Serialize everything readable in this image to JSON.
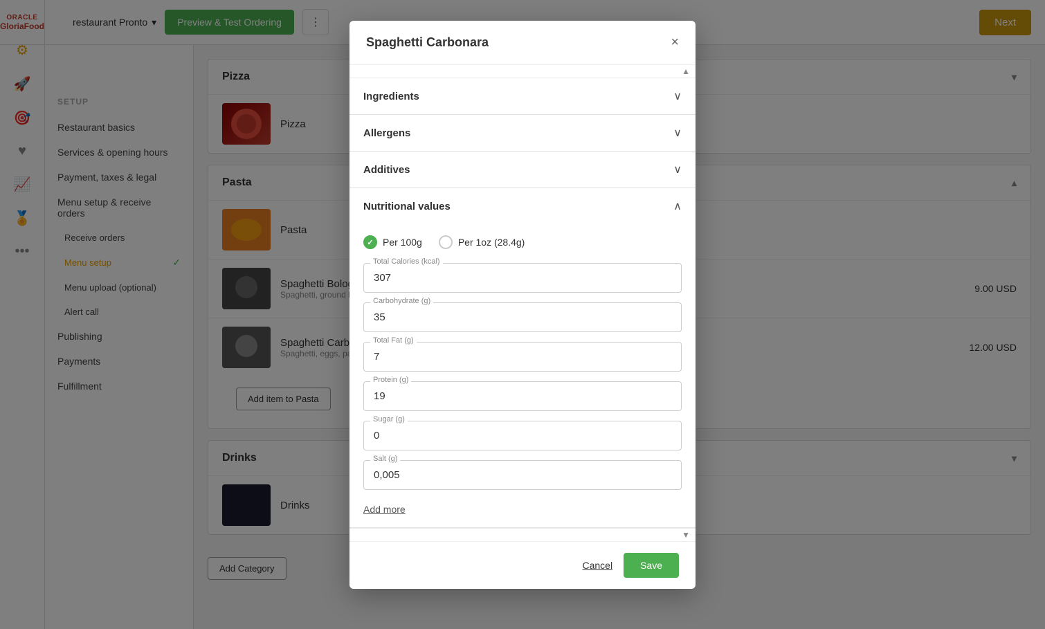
{
  "oracle": {
    "line1": "ORACLE",
    "line2": "GloriaFood"
  },
  "topbar": {
    "restaurant": "restaurant Pronto",
    "preview_label": "Preview & Test Ordering",
    "next_label": "Next"
  },
  "sidebar": {
    "setup_label": "SETUP",
    "nav_items": [
      {
        "label": "Restaurant basics",
        "sub": false
      },
      {
        "label": "Services & opening hours",
        "sub": false
      },
      {
        "label": "Payment, taxes & legal",
        "sub": false
      },
      {
        "label": "Menu setup & receive orders",
        "sub": false
      },
      {
        "label": "Receive orders",
        "sub": true
      },
      {
        "label": "Menu setup",
        "sub": true,
        "active": true,
        "check": true
      },
      {
        "label": "Menu upload (optional)",
        "sub": true
      },
      {
        "label": "Alert call",
        "sub": true
      },
      {
        "label": "Publishing",
        "sub": false
      },
      {
        "label": "Payments",
        "sub": false
      },
      {
        "label": "Fulfillment",
        "sub": false
      }
    ]
  },
  "categories": [
    {
      "name": "Pizza",
      "collapsed": true,
      "items": [
        {
          "name": "Pizza",
          "img_type": "pizza"
        }
      ]
    },
    {
      "name": "Pasta",
      "collapsed": false,
      "items": [
        {
          "name": "Pasta",
          "img_type": "pasta"
        },
        {
          "name": "Spaghetti Bolognese",
          "desc": "Spaghetti, ground be...",
          "price": "9.00 USD",
          "img_type": "spaghetti-bol"
        },
        {
          "name": "Spaghetti Carbonara",
          "desc": "Spaghetti, eggs, panc...",
          "price": "12.00 USD",
          "img_type": "spaghetti-car"
        }
      ],
      "add_item_label": "Add item to Pasta"
    },
    {
      "name": "Drinks",
      "collapsed": true,
      "items": [
        {
          "name": "Drinks",
          "img_type": "drinks"
        }
      ]
    }
  ],
  "add_category_label": "Add Category",
  "modal": {
    "title": "Spaghetti Carbonara",
    "close_label": "×",
    "sections": [
      {
        "label": "Ingredients",
        "expanded": false,
        "chevron": "chevron-down"
      },
      {
        "label": "Allergens",
        "expanded": false,
        "chevron": "chevron-down"
      },
      {
        "label": "Additives",
        "expanded": false,
        "chevron": "chevron-down"
      },
      {
        "label": "Nutritional values",
        "expanded": true,
        "chevron": "chevron-up"
      }
    ],
    "nutritional": {
      "options": [
        {
          "label": "Per 100g",
          "checked": true
        },
        {
          "label": "Per 1oz (28.4g)",
          "checked": false
        }
      ],
      "fields": [
        {
          "label": "Total Calories (kcal)",
          "value": "307"
        },
        {
          "label": "Carbohydrate (g)",
          "value": "35"
        },
        {
          "label": "Total Fat (g)",
          "value": "7"
        },
        {
          "label": "Protein (g)",
          "value": "19"
        },
        {
          "label": "Sugar (g)",
          "value": "0"
        },
        {
          "label": "Salt (g)",
          "value": "0,005"
        }
      ],
      "add_more_label": "Add more"
    },
    "footer": {
      "cancel_label": "Cancel",
      "save_label": "Save"
    }
  }
}
